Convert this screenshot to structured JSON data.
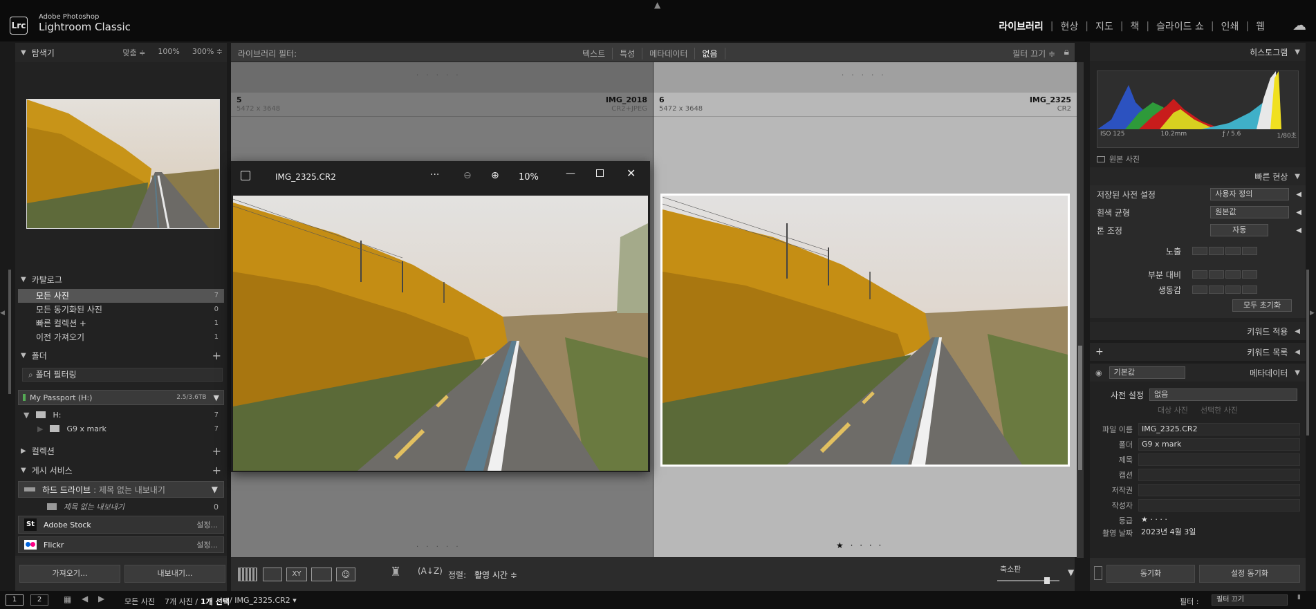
{
  "app": {
    "brand_top": "Adobe Photoshop",
    "brand_main": "Lightroom Classic",
    "logo": "Lrc"
  },
  "modules": [
    {
      "label": "라이브러리",
      "active": true
    },
    {
      "label": "현상"
    },
    {
      "label": "지도"
    },
    {
      "label": "책"
    },
    {
      "label": "슬라이드 쇼"
    },
    {
      "label": "인쇄"
    },
    {
      "label": "웹"
    }
  ],
  "navigator": {
    "title": "탐색기",
    "opts": [
      "맞춤 ≑",
      "100%",
      "300% ≑"
    ]
  },
  "catalog": {
    "title": "카탈로그",
    "items": [
      {
        "label": "모든 사진",
        "count": "7"
      },
      {
        "label": "모든 동기화된 사진",
        "count": "0"
      },
      {
        "label": "빠른 컬렉션 +",
        "count": "1"
      },
      {
        "label": "이전 가져오기",
        "count": "1"
      }
    ]
  },
  "folders": {
    "title": "폴더",
    "filter_placeholder": "폴더 필터링",
    "volume": {
      "name": "My Passport (H:)",
      "size": "2.5/3.6TB"
    },
    "tree": [
      {
        "label": "H:",
        "count": "7"
      },
      {
        "label": "G9 x mark",
        "count": "7"
      }
    ]
  },
  "collections": {
    "title": "컬렉션"
  },
  "publish": {
    "title": "게시 서비스",
    "hard_drive": {
      "label": "하드 드라이브",
      "sub": ": 제목 없는 내보내기"
    },
    "export_item": {
      "label": "제목 없는 내보내기",
      "count": "0"
    },
    "services": [
      {
        "label": "Adobe Stock",
        "action": "설정..."
      },
      {
        "label": "Flickr",
        "action": "설정..."
      }
    ]
  },
  "left_buttons": {
    "import": "가져오기...",
    "export": "내보내기..."
  },
  "filter_bar": {
    "title": "라이브러리 필터:",
    "items": [
      "텍스트",
      "특성",
      "메타데이터",
      "없음"
    ],
    "active": "없음",
    "right": "필터 끄기 ≑"
  },
  "cells": [
    {
      "num": "5",
      "dims": "5472 x 3648",
      "name": "IMG_2018",
      "ext": "CR2+JPEG"
    },
    {
      "num": "6",
      "dims": "5472 x 3648",
      "name": "IMG_2325",
      "ext": "CR2"
    }
  ],
  "viewer": {
    "filename": "IMG_2325.CR2",
    "zoom": "10%",
    "more": "···"
  },
  "rating_dots": "★ · · · ·",
  "top_dots": "· · · · ·",
  "toolbar": {
    "sort_label": "정렬:",
    "sort_value": "활영 시간 ≑",
    "thumb_label": "축소판"
  },
  "right_panel": {
    "histogram": {
      "title": "히스토그램",
      "iso": "ISO 125",
      "focal": "10.2mm",
      "aperture": "ƒ / 5.6",
      "shutter": "1/80초",
      "original": "원본 사진"
    },
    "quick_develop": {
      "title": "빠른 현상",
      "preset_label": "저장된 사전 설정",
      "preset_value": "사용자 정의",
      "wb_label": "흰색 균형",
      "wb_value": "원본값",
      "tone_label": "톤 조정",
      "auto_btn": "자동",
      "exposure": "노출",
      "clarity": "부분 대비",
      "vibrance": "생동감",
      "reset": "모두 초기화"
    },
    "keywording": "키워드 적용",
    "keyword_list": "키워드 목록",
    "metadata": {
      "title": "메타데이터",
      "preset_set": "기본값",
      "preset_label": "사전 설정",
      "preset_value": "없음",
      "target_a": "대상 사진",
      "target_b": "선택한 사진",
      "fields": [
        {
          "k": "파일 이름",
          "v": "IMG_2325.CR2"
        },
        {
          "k": "폴더",
          "v": "G9 x mark"
        },
        {
          "k": "제목",
          "v": ""
        },
        {
          "k": "캡션",
          "v": ""
        },
        {
          "k": "저작권",
          "v": ""
        },
        {
          "k": "작성자",
          "v": ""
        },
        {
          "k": "등급",
          "v": "★ · · · ·"
        },
        {
          "k": "촬영 날짜",
          "v": "2023년 4월 3일"
        }
      ]
    },
    "sync_btn": "동기화",
    "sync_settings_btn": "설정 동기화"
  },
  "filmstrip": {
    "mon1": "1",
    "mon2": "2",
    "source": "모든 사진",
    "count": "7개 사진 /",
    "selected": "1개 선택",
    "file": "/ IMG_2325.CR2 ▾",
    "filter_label": "필터 :",
    "filter_value": "필터 끄기"
  },
  "colors": {
    "accent": "#ffffff",
    "panel": "#222222",
    "grid_dark": "#7b7b7b",
    "grid_light": "#b8b8b8"
  }
}
